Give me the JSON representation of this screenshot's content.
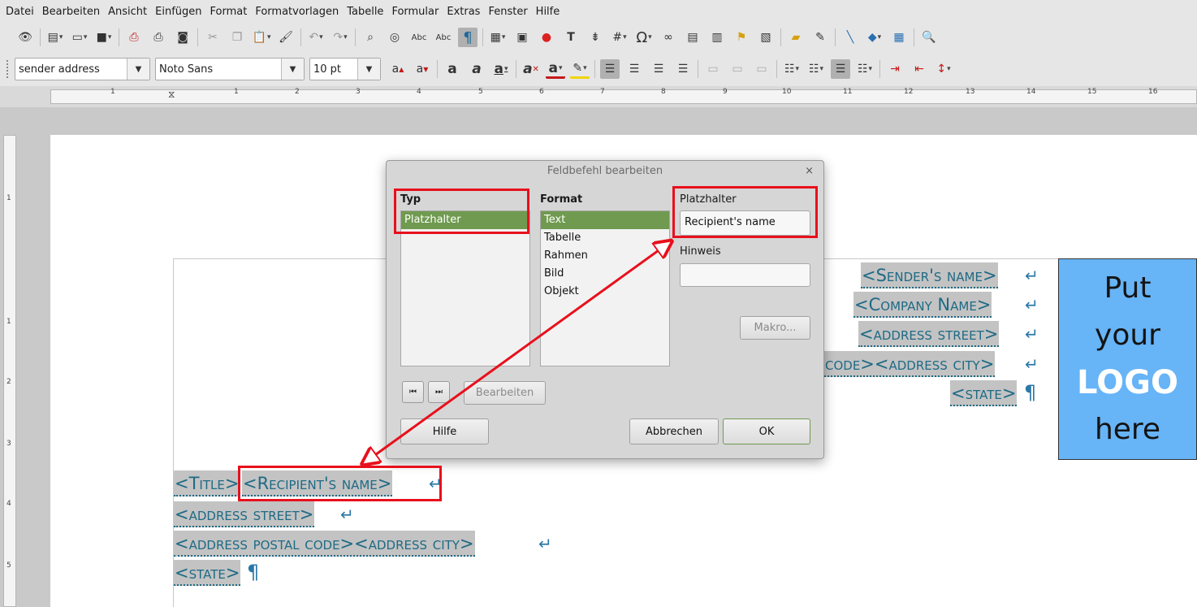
{
  "menu": [
    "Datei",
    "Bearbeiten",
    "Ansicht",
    "Einfügen",
    "Format",
    "Formatvorlagen",
    "Tabelle",
    "Formular",
    "Extras",
    "Fenster",
    "Hilfe"
  ],
  "format_bar": {
    "paragraph_style": "sender address",
    "font_name": "Noto Sans",
    "font_size": "10 pt"
  },
  "toolbar_icons": {
    "standard": [
      "find-icon",
      "new-document-icon",
      "open-icon",
      "save-icon",
      "export-pdf-icon",
      "print-icon",
      "print-preview-icon",
      "cut-icon",
      "copy-icon",
      "paste-icon",
      "clone-format-icon",
      "undo-icon",
      "redo-icon",
      "find-replace-icon",
      "navigator-icon",
      "spellcheck-icon",
      "autospellcheck-icon",
      "formatting-marks-icon",
      "insert-table-icon",
      "insert-image-icon",
      "insert-chart-icon",
      "insert-textbox-icon",
      "page-break-icon",
      "insert-field-icon",
      "special-character-icon",
      "hyperlink-icon",
      "footnote-icon",
      "endnote-icon",
      "bookmark-icon",
      "cross-reference-icon",
      "comment-icon",
      "track-changes-icon",
      "line-icon",
      "basic-shapes-icon",
      "grid-icon",
      "zoom-icon"
    ],
    "formatting": [
      "grow-font-icon",
      "shrink-font-icon",
      "bold-icon",
      "italic-icon",
      "underline-icon",
      "clear-format-icon",
      "font-color-icon",
      "highlight-icon",
      "align-left-icon",
      "align-center-icon",
      "align-right-icon",
      "justify-icon",
      "bullets-icon",
      "numbering-icon",
      "outline-icon",
      "indent-icon",
      "outdent-icon",
      "line-spacing-icon"
    ]
  },
  "ruler": {
    "h_numbers": [
      "1",
      "1",
      "2",
      "3",
      "4",
      "5",
      "6",
      "7",
      "8",
      "9",
      "10",
      "11",
      "12",
      "13",
      "14",
      "15",
      "16"
    ],
    "v_numbers": [
      "1",
      "1",
      "2",
      "3",
      "4",
      "5"
    ]
  },
  "document": {
    "sender": [
      {
        "text": "<Sender's name>",
        "end": "↵"
      },
      {
        "text": "<Company Name>",
        "end": "↵"
      },
      {
        "text": "<address street>",
        "end": "↵"
      },
      {
        "text": "code><address city>",
        "end": "↵"
      },
      {
        "text": "<state>",
        "end": "¶"
      }
    ],
    "recipient": {
      "title": "<Title>",
      "name": "<Recipient's name>",
      "name_end": "↵",
      "street": "<address street>",
      "street_end": "↵",
      "city_line": "<address postal code><address city>",
      "city_end": "↵",
      "state": "<state>",
      "state_end": "¶"
    },
    "logo": {
      "line1": "Put",
      "line2": "your",
      "line3": "LOGO",
      "line4": "here"
    }
  },
  "dialog": {
    "title": "Feldbefehl bearbeiten",
    "close": "×",
    "type_label": "Typ",
    "type_items": [
      "Platzhalter"
    ],
    "format_label": "Format",
    "format_items": [
      "Text",
      "Tabelle",
      "Rahmen",
      "Bild",
      "Objekt"
    ],
    "placeholder_label": "Platzhalter",
    "placeholder_value": "Recipient's name",
    "hint_label": "Hinweis",
    "hint_value": "",
    "macro_button": "Makro...",
    "prev_symbol": "⏮",
    "next_symbol": "⏭",
    "edit_button": "Bearbeiten",
    "help_button": "Hilfe",
    "cancel_button": "Abbrechen",
    "ok_button": "OK"
  },
  "annotation_color": "#e8101c",
  "accent_colors": {
    "selection": "#6f9a4f",
    "field_text": "#1e6a85",
    "logo_bg": "#67b4f7"
  }
}
